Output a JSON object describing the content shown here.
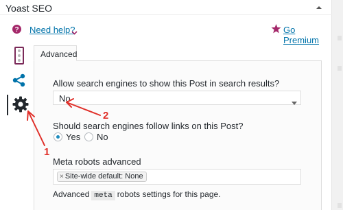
{
  "panel": {
    "title": "Yoast SEO"
  },
  "help": {
    "link_label": "Need help?",
    "premium_label": "Go Premium"
  },
  "tabs": {
    "advanced_label": "Advanced"
  },
  "advanced": {
    "search_question": "Allow search engines to show this Post in search results?",
    "search_value": "No",
    "follow_question": "Should search engines follow links on this Post?",
    "radio_yes": "Yes",
    "radio_no": "No",
    "radio_selected": "Yes",
    "meta_label": "Meta robots advanced",
    "meta_chip": "Site-wide default: None",
    "desc_before": "Advanced",
    "desc_code": "meta",
    "desc_after": "robots settings for this page."
  },
  "annotations": {
    "one": "1",
    "two": "2"
  },
  "colors": {
    "link": "#0073aa",
    "brand": "#a4286a",
    "annotation": "#e0302a",
    "radio_on": "#1e8cbe"
  },
  "icons": {
    "help": "question-circle-icon",
    "premium": "star-icon",
    "readability": "traffic-light-icon",
    "social": "share-icon",
    "settings": "gear-icon"
  }
}
